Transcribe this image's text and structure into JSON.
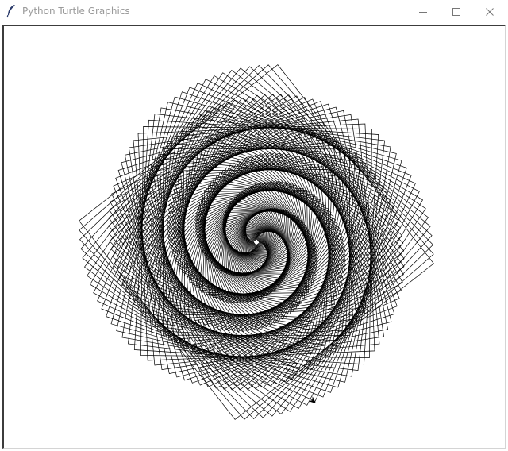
{
  "window": {
    "title": "Python Turtle Graphics",
    "icon": "feather-icon",
    "controls": {
      "minimize": "minimize-icon",
      "maximize": "maximize-icon",
      "close": "close-icon"
    }
  },
  "canvas": {
    "background": "#ffffff",
    "pen_color": "#000000",
    "drawing": "rotating-square-spiral",
    "turtle_shape": "classic-arrow"
  }
}
